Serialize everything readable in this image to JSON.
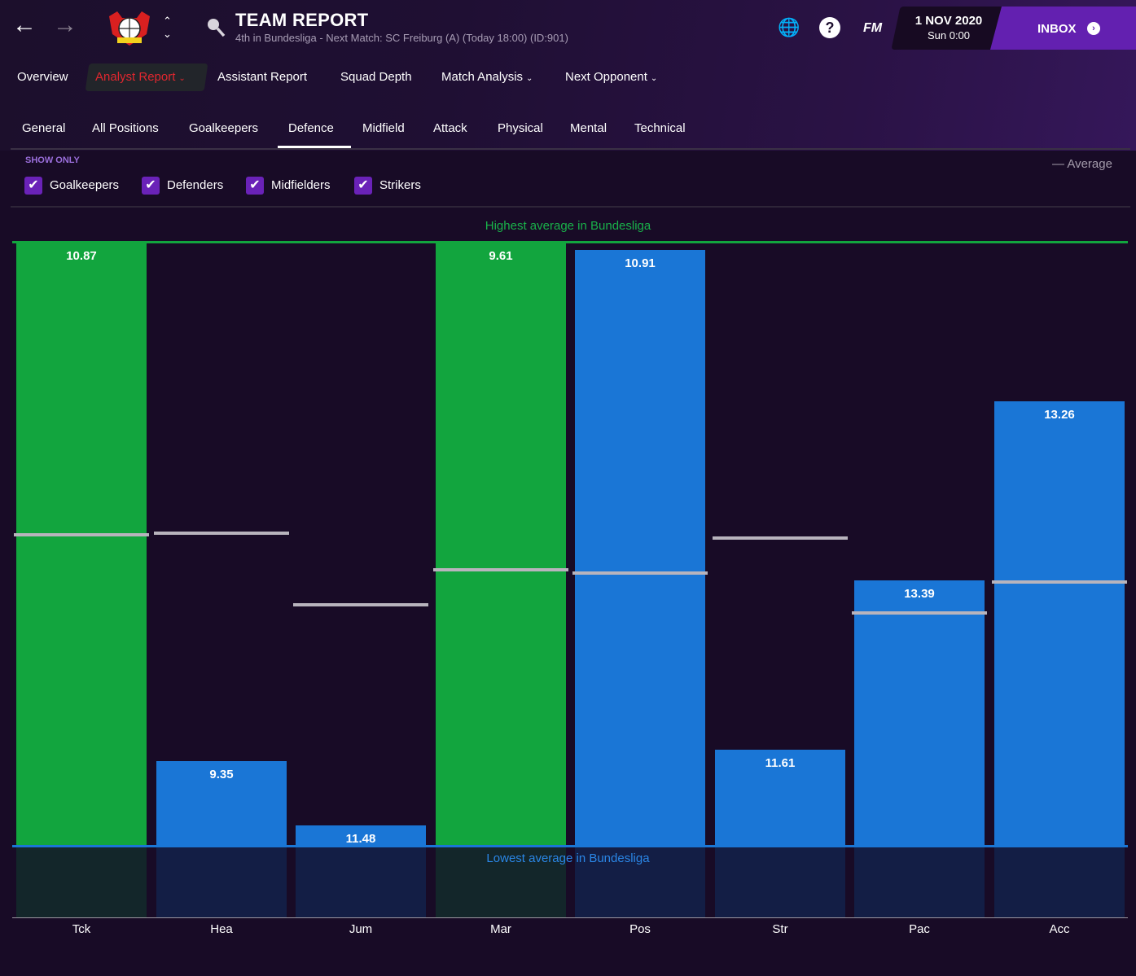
{
  "header": {
    "title": "TEAM REPORT",
    "subtitle": "4th in Bundesliga - Next Match: SC Freiburg (A) (Today 18:00) (ID:901)",
    "date": "1 NOV 2020",
    "time": "Sun 0:00",
    "inbox": "INBOX",
    "fm": "FM"
  },
  "menu": {
    "items": [
      {
        "label": "Overview"
      },
      {
        "label": "Analyst Report",
        "active": true,
        "dropdown": true
      },
      {
        "label": "Assistant Report"
      },
      {
        "label": "Squad Depth"
      },
      {
        "label": "Match Analysis",
        "dropdown": true
      },
      {
        "label": "Next Opponent",
        "dropdown": true
      }
    ]
  },
  "tabs": {
    "items": [
      {
        "label": "General"
      },
      {
        "label": "All Positions"
      },
      {
        "label": "Goalkeepers"
      },
      {
        "label": "Defence",
        "selected": true
      },
      {
        "label": "Midfield"
      },
      {
        "label": "Attack"
      },
      {
        "label": "Physical"
      },
      {
        "label": "Mental"
      },
      {
        "label": "Technical"
      }
    ]
  },
  "filters": {
    "heading": "SHOW ONLY",
    "items": [
      {
        "label": "Goalkeepers",
        "checked": true
      },
      {
        "label": "Defenders",
        "checked": true
      },
      {
        "label": "Midfielders",
        "checked": true
      },
      {
        "label": "Strikers",
        "checked": true
      }
    ]
  },
  "legend": {
    "average": "— Average"
  },
  "colors": {
    "highest": "#12a53e",
    "normal": "#1a76d6",
    "accent": "#6320b0",
    "active_menu": "#e0272f"
  },
  "chart_data": {
    "type": "bar",
    "highest_label": "Highest average in Bundesliga",
    "lowest_label": "Lowest average in Bundesliga",
    "categories": [
      "Tck",
      "Hea",
      "Jum",
      "Mar",
      "Pos",
      "Str",
      "Pac",
      "Acc"
    ],
    "values": [
      10.87,
      9.35,
      11.48,
      9.61,
      10.91,
      11.61,
      13.39,
      13.26
    ],
    "value_labels": [
      "10.87",
      "9.35",
      "11.48",
      "9.61",
      "10.91",
      "11.61",
      "13.39",
      "13.26"
    ],
    "level_between_lowest_and_highest": [
      1.0,
      0.14,
      0.034,
      1.0,
      0.988,
      0.159,
      0.44,
      0.737
    ],
    "average_level_between_lowest_and_highest": [
      0.516,
      0.518,
      0.399,
      0.457,
      0.452,
      0.51,
      0.386,
      0.437
    ],
    "is_highest": [
      true,
      false,
      false,
      true,
      false,
      false,
      false,
      false
    ]
  }
}
